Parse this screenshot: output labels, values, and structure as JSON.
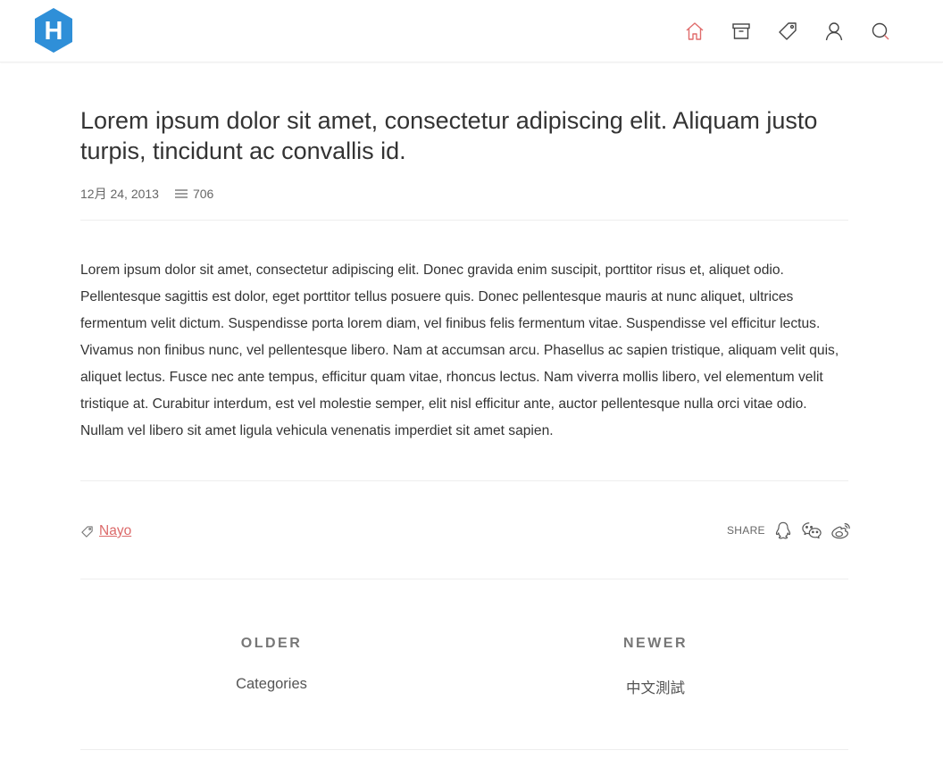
{
  "header": {
    "logo_letter": "H",
    "logo_color": "#2f8fd8",
    "nav": [
      {
        "name": "home",
        "icon": "home-icon",
        "active_color": "#e06c6c"
      },
      {
        "name": "archive",
        "icon": "archive-icon"
      },
      {
        "name": "tags",
        "icon": "tag-icon"
      },
      {
        "name": "about",
        "icon": "user-icon"
      },
      {
        "name": "search",
        "icon": "search-icon"
      }
    ]
  },
  "post": {
    "title": "Lorem ipsum dolor sit amet, consectetur adipiscing elit. Aliquam justo turpis, tincidunt ac convallis id.",
    "date": "12月 24, 2013",
    "word_count": "706",
    "body": "Lorem ipsum dolor sit amet, consectetur adipiscing elit. Donec gravida enim suscipit, porttitor risus et, aliquet odio. Pellentesque sagittis est dolor, eget porttitor tellus posuere quis. Donec pellentesque mauris at nunc aliquet, ultrices fermentum velit dictum. Suspendisse porta lorem diam, vel finibus felis fermentum vitae. Suspendisse vel efficitur lectus. Vivamus non finibus nunc, vel pellentesque libero. Nam at accumsan arcu. Phasellus ac sapien tristique, aliquam velit quis, aliquet lectus. Fusce nec ante tempus, efficitur quam vitae, rhoncus lectus. Nam viverra mollis libero, vel elementum velit tristique at. Curabitur interdum, est vel molestie semper, elit nisl efficitur ante, auctor pellentesque nulla orci vitae odio. Nullam vel libero sit amet ligula vehicula venenatis imperdiet sit amet sapien.",
    "tag": "Nayo",
    "tag_color": "#dc6a6a",
    "share_label": "SHARE",
    "share_icons": [
      "qq-icon",
      "wechat-icon",
      "weibo-icon"
    ]
  },
  "pager": {
    "older_label": "OLDER",
    "older_link": "Categories",
    "newer_label": "NEWER",
    "newer_link": "中文測試"
  }
}
